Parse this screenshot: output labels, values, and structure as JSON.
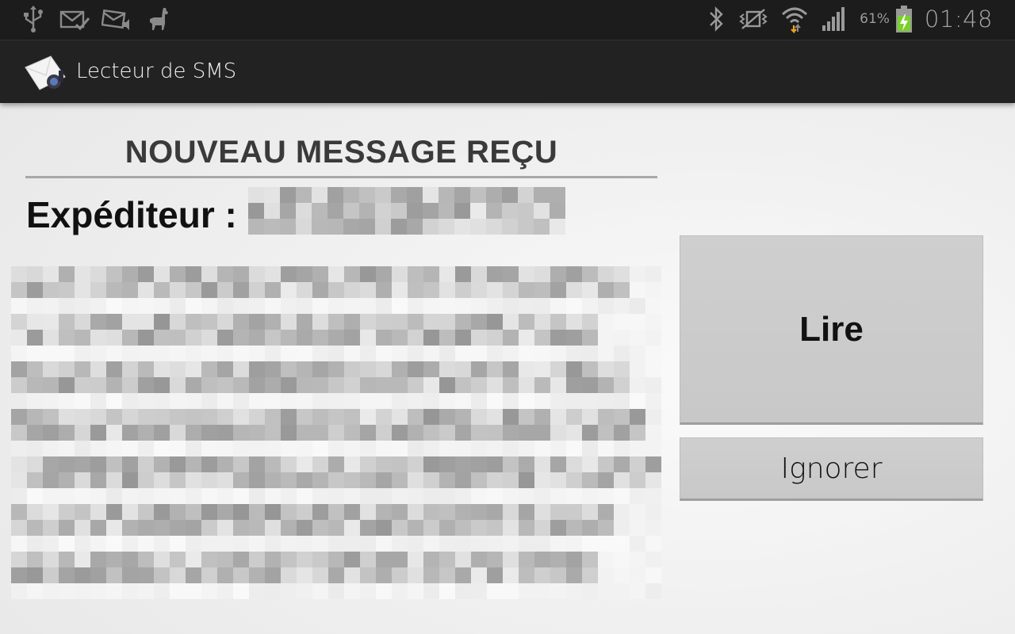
{
  "status_bar": {
    "left_icons": [
      "usb-icon",
      "mail-check-icon",
      "mail-sound-icon",
      "llama-icon"
    ],
    "right_icons": [
      "bluetooth-icon",
      "vibrate-icon",
      "wifi-icon",
      "signal-icon",
      "battery-charging-icon"
    ],
    "battery_percent": "61%",
    "time": "01:48"
  },
  "action_bar": {
    "app_icon": "envelope-icon",
    "title": "Lecteur de SMS"
  },
  "message": {
    "heading": "NOUVEAU MESSAGE REÇU",
    "sender_label": "Expéditeur :",
    "sender_value": "(pixelated)",
    "body": "(pixelated)"
  },
  "buttons": {
    "read_label": "Lire",
    "ignore_label": "Ignorer"
  },
  "colors": {
    "status_bar_bg": "#1c1c1c",
    "action_bar_bg": "#222222",
    "button_bg": "#cccccc",
    "battery_green": "#7ad12a",
    "wifi_arrow_orange": "#f0a020"
  }
}
